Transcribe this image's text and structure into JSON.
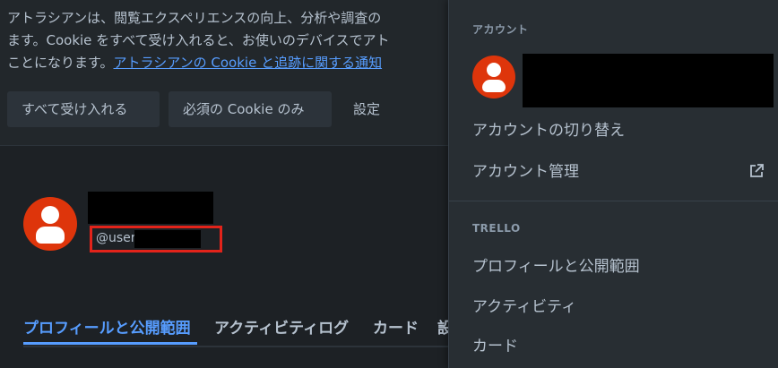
{
  "cookie_banner": {
    "text_line1": "アトラシアンは、閲覧エクスペリエンスの向上、分析や調査の",
    "text_line2": "ます。Cookie をすべて受け入れると、お使いのデバイスでアト",
    "text_line3_prefix": "ことになります。",
    "link_text": "アトラシアンの Cookie と追跡に関する通知",
    "buttons": {
      "accept_all": "すべて受け入れる",
      "necessary_only": "必須の Cookie のみ",
      "settings": "設定"
    }
  },
  "profile": {
    "username_prefix": "@user",
    "tabs": {
      "profile": "プロフィールと公開範囲",
      "activity": "アクティビティログ",
      "cards": "カード",
      "more": "設"
    }
  },
  "account_menu": {
    "section_account": "アカウント",
    "switch_account": "アカウントの切り替え",
    "manage_account": "アカウント管理",
    "section_trello": "TRELLO",
    "profile_visibility": "プロフィールと公開範囲",
    "activity": "アクティビティ",
    "cards": "カード"
  },
  "colors": {
    "background": "#1d2125",
    "menu_background": "#282e33",
    "accent": "#579dff",
    "avatar": "#de350b",
    "highlight_box": "#e2231a"
  },
  "icons": {
    "external_link": "external-link-icon",
    "avatar": "user-avatar-icon"
  }
}
